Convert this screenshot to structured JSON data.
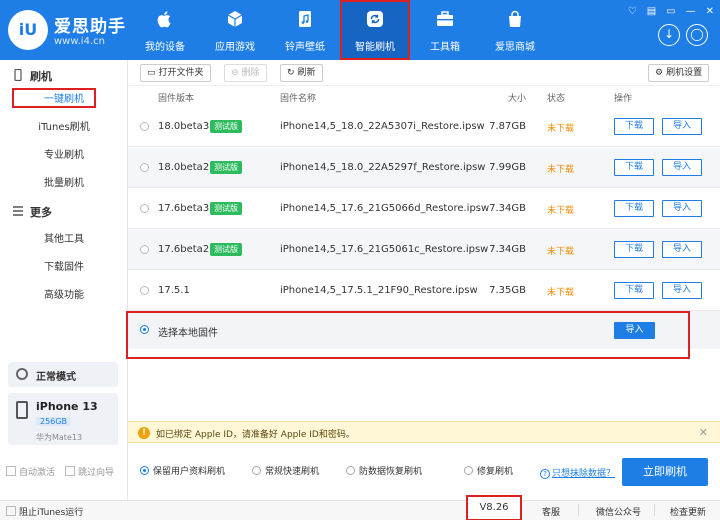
{
  "app": {
    "logo_text": "iU",
    "brand": "爱思助手",
    "url": "www.i4.cn"
  },
  "nav": [
    {
      "label": "我的设备",
      "icon": "apple-icon"
    },
    {
      "label": "应用游戏",
      "icon": "cube-icon"
    },
    {
      "label": "铃声壁纸",
      "icon": "music-file-icon"
    },
    {
      "label": "智能刷机",
      "icon": "refresh-circle-icon",
      "active": true
    },
    {
      "label": "工具箱",
      "icon": "toolbox-icon"
    },
    {
      "label": "爱思商城",
      "icon": "shopping-bag-icon"
    }
  ],
  "header_buttons": {
    "download": "↓",
    "user": "◯"
  },
  "window_controls": [
    "♡",
    "▤",
    "▭",
    "—",
    "✕"
  ],
  "sidebar": {
    "flash_heading": "刷机",
    "items": [
      "一键刷机",
      "iTunes刷机",
      "专业刷机",
      "批量刷机"
    ],
    "more_heading": "更多",
    "more_items": [
      "其他工具",
      "下载固件",
      "高级功能"
    ],
    "mode": "正常模式",
    "device": {
      "name": "iPhone 13",
      "capacity": "256GB",
      "alias": "华为Mate13"
    },
    "checks": [
      "自动激活",
      "跳过向导"
    ]
  },
  "toolbar": {
    "open_folder": "打开文件夹",
    "delete": "删除",
    "refresh": "刷新",
    "settings": "刷机设置"
  },
  "table": {
    "headers": {
      "version": "固件版本",
      "name": "固件名称",
      "size": "大小",
      "status": "状态",
      "action": "操作"
    },
    "rows": [
      {
        "version": "18.0beta3",
        "badge": "测试版",
        "name": "iPhone14,5_18.0_22A5307i_Restore.ipsw",
        "size": "7.87GB",
        "status": "未下载",
        "download": "下载",
        "import": "导入"
      },
      {
        "version": "18.0beta2",
        "badge": "测试版",
        "name": "iPhone14,5_18.0_22A5297f_Restore.ipsw",
        "size": "7.99GB",
        "status": "未下载",
        "download": "下载",
        "import": "导入"
      },
      {
        "version": "17.6beta3",
        "badge": "测试版",
        "name": "iPhone14,5_17.6_21G5066d_Restore.ipsw",
        "size": "7.34GB",
        "status": "未下载",
        "download": "下载",
        "import": "导入"
      },
      {
        "version": "17.6beta2",
        "badge": "测试版",
        "name": "iPhone14,5_17.6_21G5061c_Restore.ipsw",
        "size": "7.34GB",
        "status": "未下载",
        "download": "下载",
        "import": "导入"
      },
      {
        "version": "17.5.1",
        "badge": "",
        "name": "iPhone14,5_17.5.1_21F90_Restore.ipsw",
        "size": "7.35GB",
        "status": "未下载",
        "download": "下载",
        "import": "导入"
      }
    ],
    "local": {
      "label": "选择本地固件",
      "import": "导入"
    }
  },
  "notice": {
    "text": "如已绑定 Apple ID，请准备好 Apple ID和密码。",
    "close": "✕"
  },
  "options": [
    "保留用户资料刷机",
    "常规快速刷机",
    "防数据恢复刷机",
    "修复刷机"
  ],
  "help_link": "只想抹除数据？",
  "flash_button": "立即刷机",
  "footer": {
    "block_itunes": "阻止iTunes运行",
    "version": "V8.26",
    "links": [
      "客服",
      "微信公众号",
      "检查更新"
    ]
  },
  "colors": {
    "primary": "#1e7ee6",
    "beta_badge": "#2dbb5d",
    "status_orange": "#f08a00",
    "highlight_red": "#e02020"
  }
}
